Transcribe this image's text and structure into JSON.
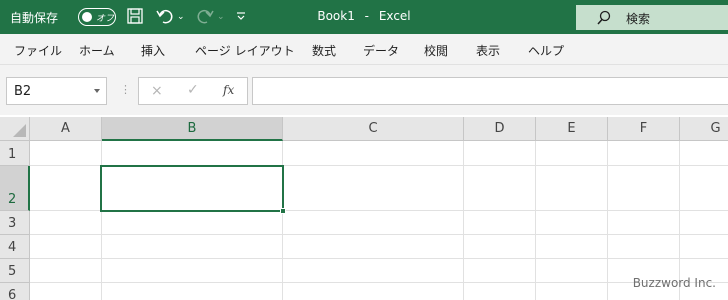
{
  "titlebar": {
    "autosave_label": "自動保存",
    "autosave_state": "オフ",
    "title": "Book1",
    "title_sep": "-",
    "app_name": "Excel",
    "search_placeholder": "検索",
    "icons": {
      "save": "save-icon",
      "undo": "undo-icon",
      "redo": "redo-icon",
      "customize": "customize-qat-icon"
    },
    "colors": {
      "background": "#217346",
      "search_bg": "#c6dfcd"
    }
  },
  "ribbon": {
    "tabs": [
      "ファイル",
      "ホーム",
      "挿入",
      "ページ レイアウト",
      "数式",
      "データ",
      "校閲",
      "表示",
      "ヘルプ"
    ]
  },
  "formula_bar": {
    "name_box": "B2",
    "formula": "",
    "cancel_icon": "×",
    "enter_icon": "✓",
    "fx_label": "fx"
  },
  "grid": {
    "columns": [
      "A",
      "B",
      "C",
      "D",
      "E",
      "F",
      "G"
    ],
    "rows": [
      "1",
      "2",
      "3",
      "4",
      "5",
      "6"
    ],
    "selected_cell": "B2",
    "accent": "#217346"
  },
  "watermark": "Buzzword Inc."
}
